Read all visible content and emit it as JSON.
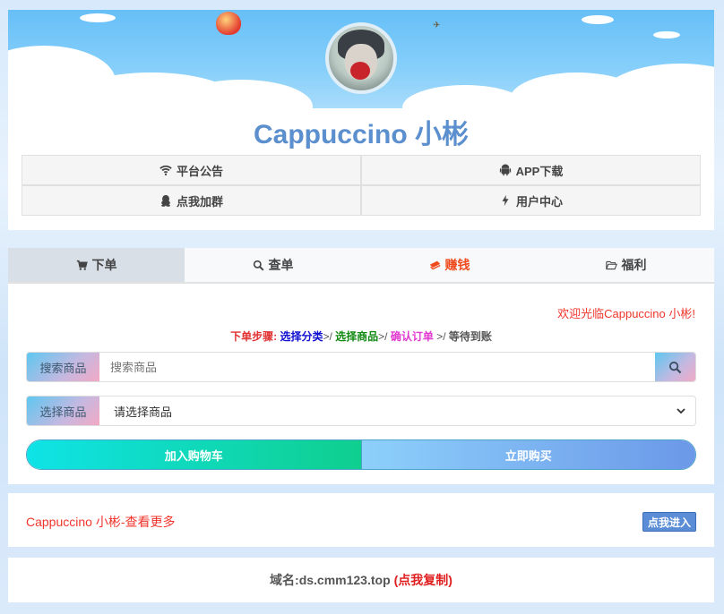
{
  "header": {
    "title": "Cappuccino 小彬",
    "nav": [
      {
        "label": "平台公告",
        "icon": "wifi-icon"
      },
      {
        "label": "APP下载",
        "icon": "android-icon"
      },
      {
        "label": "点我加群",
        "icon": "qq-icon"
      },
      {
        "label": "用户中心",
        "icon": "bolt-icon"
      }
    ]
  },
  "tabs": [
    {
      "label": "下单",
      "icon": "cart-icon"
    },
    {
      "label": "查单",
      "icon": "search-icon"
    },
    {
      "label": "赚钱",
      "icon": "money-icon"
    },
    {
      "label": "福利",
      "icon": "folder-open-icon"
    }
  ],
  "order": {
    "welcome": "欢迎光临Cappuccino 小彬!",
    "steps": {
      "label": "下单步骤:",
      "step1": "选择分类",
      "step2": "选择商品",
      "step3": "确认订单",
      "step4": "等待到账",
      "arrow": ">/"
    },
    "search": {
      "addon": "搜索商品",
      "placeholder": "搜索商品"
    },
    "select": {
      "addon": "选择商品",
      "value": "请选择商品"
    },
    "cart_button": "加入购物车",
    "buy_button": "立即购买"
  },
  "more": {
    "text": "Cappuccino 小彬-查看更多",
    "button": "点我进入"
  },
  "domain": {
    "label": "域名:ds.cmm123.top",
    "copy": "(点我复制)"
  },
  "colors": {
    "title": "#5b8fce",
    "accent_red": "#f0352b",
    "tab_active": "#d9dfe6"
  }
}
